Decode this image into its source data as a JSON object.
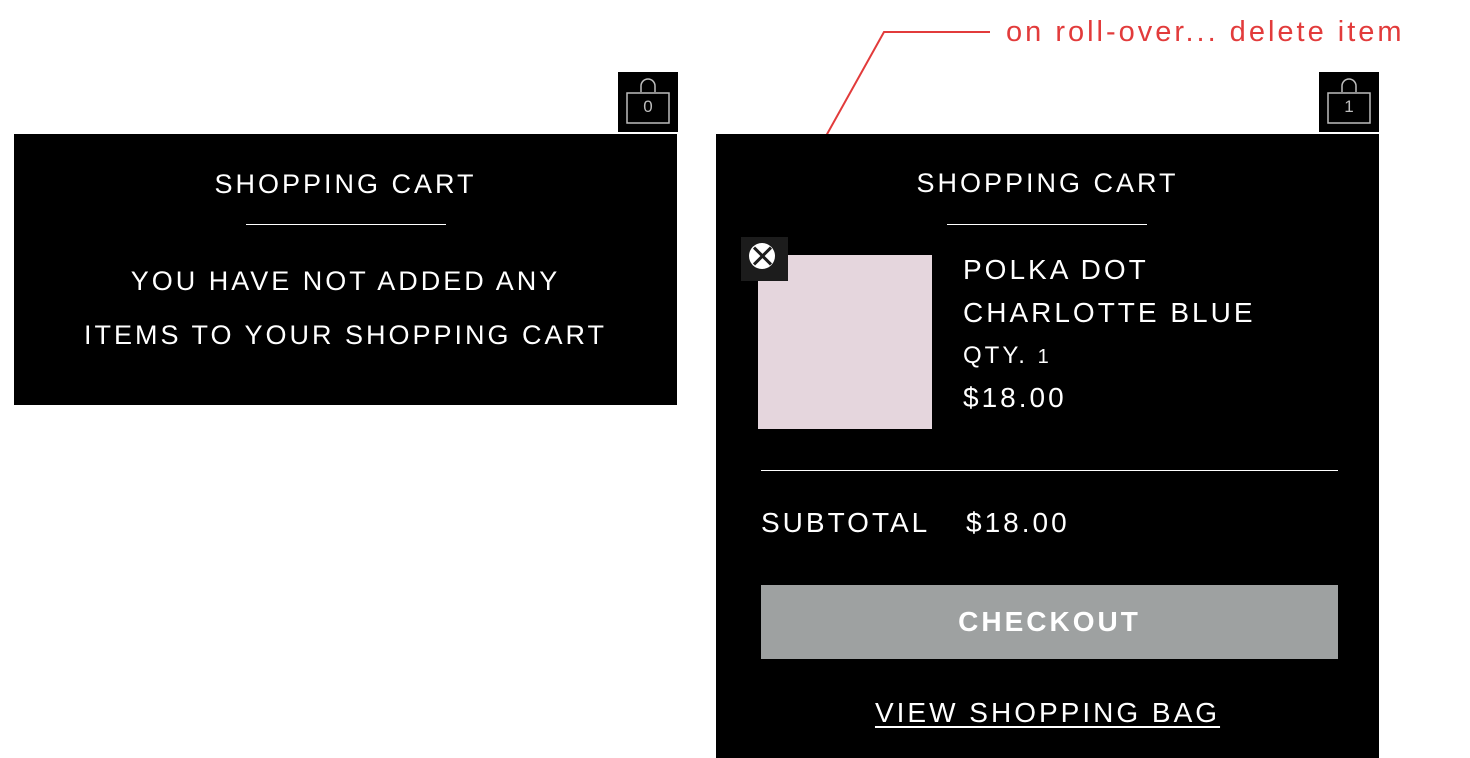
{
  "annotation": {
    "text": "on roll-over... delete item",
    "color": "#e23b3b"
  },
  "empty_cart": {
    "bag_icon": {
      "name": "shopping-bag-icon",
      "count": "0"
    },
    "title": "SHOPPING CART",
    "message_lines": [
      "YOU HAVE NOT ADDED ANY",
      "ITEMS TO YOUR SHOPPING CART"
    ]
  },
  "filled_cart": {
    "bag_icon": {
      "name": "shopping-bag-icon",
      "count": "1"
    },
    "title": "SHOPPING CART",
    "delete_icon": "close-circle-icon",
    "item": {
      "name_line1": "POLKA DOT",
      "name_line2": "CHARLOTTE BLUE",
      "qty_label": "QTY.",
      "qty_value": "1",
      "price": "$18.00",
      "thumbnail_color": "#e5d6dd"
    },
    "subtotal_label": "SUBTOTAL",
    "subtotal_value": "$18.00",
    "checkout_label": "CHECKOUT",
    "view_bag_label": "VIEW SHOPPING BAG"
  },
  "colors": {
    "panel_bg": "#000000",
    "checkout_bg": "#9ea1a1"
  }
}
